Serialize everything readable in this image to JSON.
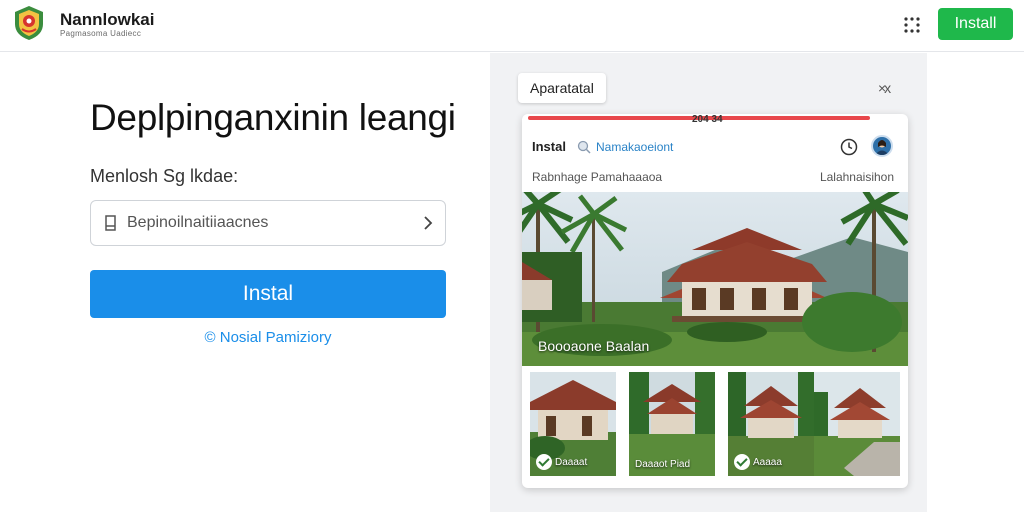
{
  "header": {
    "brand_name": "Nannlowkai",
    "brand_sub": "Pagmasoma Uadiecc",
    "install_label": "Install"
  },
  "main": {
    "headline": "Deplpinganxinin leangi",
    "field_label": "Menlosh Sg lkdae:",
    "search_value": "Bepinoilnaitiiaacnes",
    "install_label": "Instal",
    "policy_link": "© Nosial Pamiziory"
  },
  "dialog": {
    "title": "Aparatatal",
    "close_label": "×x"
  },
  "phone": {
    "status_time": "204 34",
    "app_bar": {
      "install_label": "Instal",
      "search_text": "Namakaoeiont"
    },
    "crumb_left": "Rabnhage Pamahaaaoa",
    "crumb_right": "Lalahnaisihon",
    "hero_caption": "Boooaone Baalan",
    "thumbnails": [
      {
        "label": "Daaaat",
        "checked": true
      },
      {
        "label": "Daaaot Piad",
        "checked": false
      },
      {
        "label": "Aaaaa",
        "checked": true
      },
      {
        "label": "",
        "checked": false
      }
    ]
  },
  "colors": {
    "install_green": "#1fb84b",
    "primary_blue": "#1a8ee9",
    "status_red": "#e8474b"
  },
  "icons": [
    "logo-emblem",
    "grid-dots-icon",
    "document-icon",
    "chevron-right-icon",
    "search-icon",
    "clock-icon",
    "avatar",
    "check-icon"
  ]
}
